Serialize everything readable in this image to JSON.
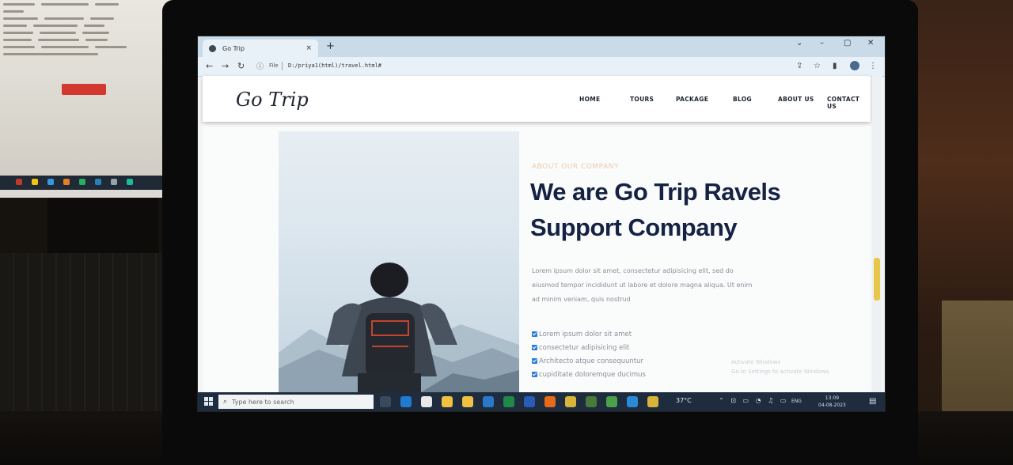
{
  "browser": {
    "tab_title": "Go Trip",
    "tab_close": "×",
    "new_tab": "+",
    "url_label": "File",
    "url": "D:/priya1(html)/travel.html#",
    "minimize": "–",
    "maximize": "▢",
    "close": "✕",
    "chevron": "⌄"
  },
  "site": {
    "logo": "Go Trip",
    "menu": [
      "HOME",
      "TOURS",
      "PACKAGE",
      "BLOG",
      "ABOUT US",
      "CONTACT US"
    ]
  },
  "about": {
    "tag": "ABOUT OUR COMPANY",
    "title_line1": "We are Go Trip Ravels",
    "title_line2": "Support Company",
    "description_line1": "Lorem ipsum dolor sit amet, consectetur adipisicing elit, sed do",
    "description_line2": "eiusmod tempor incididunt ut labore et dolore magna aliqua. Ut enim",
    "description_line3": "ad minim veniam, quis nostrud",
    "checklist": [
      "Lorem ipsum dolor sit amet",
      "consectetur adipisicing elit",
      "Architecto atque consequuntur",
      "cupiditate doloremque ducimus"
    ]
  },
  "watermark": {
    "line1": "Activate Windows",
    "line2": "Go to Settings to activate Windows."
  },
  "taskbar": {
    "search_placeholder": "Type here to search",
    "weather": "37°C",
    "language": "ENG",
    "time": "13:09",
    "date": "04-08-2023"
  },
  "colors": {
    "title": "#152244",
    "accent_tag": "#f0c9b0",
    "scroll_thumb": "#e7c74a",
    "taskbar": "#1e2c3d"
  }
}
